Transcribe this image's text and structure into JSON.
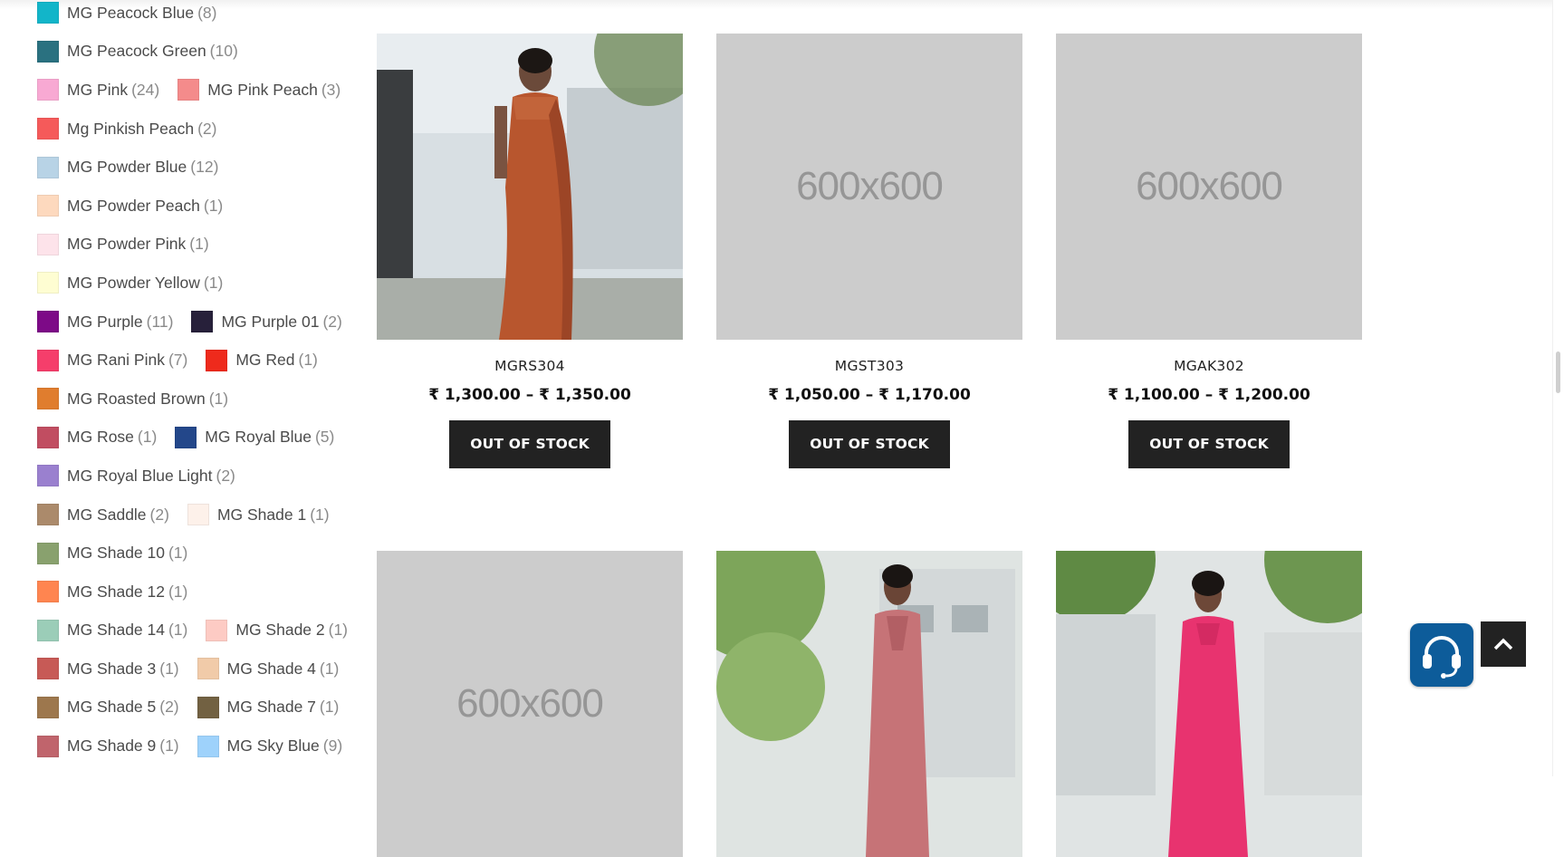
{
  "color_filters": [
    [
      {
        "label": "MG Peacock Blue",
        "count": "(8)",
        "color": "#12b5c9"
      }
    ],
    [
      {
        "label": "MG Peacock Green",
        "count": "(10)",
        "color": "#2a7180"
      }
    ],
    [
      {
        "label": "MG Pink",
        "count": "(24)",
        "color": "#f8a9d3"
      },
      {
        "label": "MG Pink Peach",
        "count": "(3)",
        "color": "#f48b8b"
      }
    ],
    [
      {
        "label": "Mg Pinkish Peach",
        "count": "(2)",
        "color": "#f55a5a"
      }
    ],
    [
      {
        "label": "MG Powder Blue",
        "count": "(12)",
        "color": "#b8d3e6"
      }
    ],
    [
      {
        "label": "MG Powder Peach",
        "count": "(1)",
        "color": "#fdd9be"
      }
    ],
    [
      {
        "label": "MG Powder Pink",
        "count": "(1)",
        "color": "#fde3ea"
      }
    ],
    [
      {
        "label": "MG Powder Yellow",
        "count": "(1)",
        "color": "#fefdd2"
      }
    ],
    [
      {
        "label": "MG Purple",
        "count": "(11)",
        "color": "#7d0a87"
      },
      {
        "label": "MG Purple 01",
        "count": "(2)",
        "color": "#27203a"
      }
    ],
    [
      {
        "label": "MG Rani Pink",
        "count": "(7)",
        "color": "#f53e6b"
      },
      {
        "label": "MG Red",
        "count": "(1)",
        "color": "#ee2a1c"
      }
    ],
    [
      {
        "label": "MG Roasted Brown",
        "count": "(1)",
        "color": "#e07d2e"
      }
    ],
    [
      {
        "label": "MG Rose",
        "count": "(1)",
        "color": "#c14d61"
      },
      {
        "label": "MG Royal Blue",
        "count": "(5)",
        "color": "#23478a"
      }
    ],
    [
      {
        "label": "MG Royal Blue Light",
        "count": "(2)",
        "color": "#9a80cf"
      }
    ],
    [
      {
        "label": "MG Saddle",
        "count": "(2)",
        "color": "#ab8a6b"
      },
      {
        "label": "MG Shade 1",
        "count": "(1)",
        "color": "#fdf1ea"
      }
    ],
    [
      {
        "label": "MG Shade 10",
        "count": "(1)",
        "color": "#89a16e"
      }
    ],
    [
      {
        "label": "MG Shade 12",
        "count": "(1)",
        "color": "#ff8550"
      }
    ],
    [
      {
        "label": "MG Shade 14",
        "count": "(1)",
        "color": "#9bcdb8"
      },
      {
        "label": "MG Shade 2",
        "count": "(1)",
        "color": "#fdcbc4"
      }
    ],
    [
      {
        "label": "MG Shade 3",
        "count": "(1)",
        "color": "#c75a56"
      },
      {
        "label": "MG Shade 4",
        "count": "(1)",
        "color": "#f1cba9"
      }
    ],
    [
      {
        "label": "MG Shade 5",
        "count": "(2)",
        "color": "#9d774d"
      },
      {
        "label": "MG Shade 7",
        "count": "(1)",
        "color": "#726142"
      }
    ],
    [
      {
        "label": "MG Shade 9",
        "count": "(1)",
        "color": "#c0646c"
      },
      {
        "label": "MG Sky Blue",
        "count": "(9)",
        "color": "#9ed2fb"
      }
    ]
  ],
  "products": [
    {
      "name": "MGRS304",
      "price": "₹ 1,300.00 – ₹ 1,350.00",
      "button": "OUT OF STOCK",
      "image": "photo-saree",
      "placeholder": ""
    },
    {
      "name": "MGST303",
      "price": "₹ 1,050.00 – ₹ 1,170.00",
      "button": "OUT OF STOCK",
      "image": "placeholder",
      "placeholder": "600x600"
    },
    {
      "name": "MGAK302",
      "price": "₹ 1,100.00 – ₹ 1,200.00",
      "button": "OUT OF STOCK",
      "image": "placeholder",
      "placeholder": "600x600"
    },
    {
      "name": "",
      "price": "",
      "button": "",
      "image": "placeholder",
      "placeholder": "600x600"
    },
    {
      "name": "",
      "price": "",
      "button": "",
      "image": "photo-kurti-rose",
      "placeholder": ""
    },
    {
      "name": "",
      "price": "",
      "button": "",
      "image": "photo-dress-pink",
      "placeholder": ""
    }
  ],
  "floating": {
    "support_icon": "headset-icon",
    "scroll_top_icon": "chevron-up-icon"
  }
}
